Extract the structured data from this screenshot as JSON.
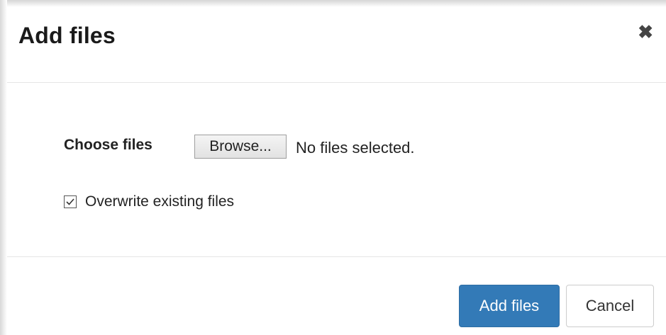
{
  "dialog": {
    "title": "Add files",
    "close_icon": "close-icon"
  },
  "form": {
    "choose_label": "Choose files",
    "browse_label": "Browse...",
    "file_status": "No files selected.",
    "overwrite_label": "Overwrite existing files",
    "overwrite_checked": true
  },
  "footer": {
    "add_label": "Add files",
    "cancel_label": "Cancel"
  },
  "colors": {
    "primary": "#337ab7",
    "border": "#e5e5e5"
  }
}
